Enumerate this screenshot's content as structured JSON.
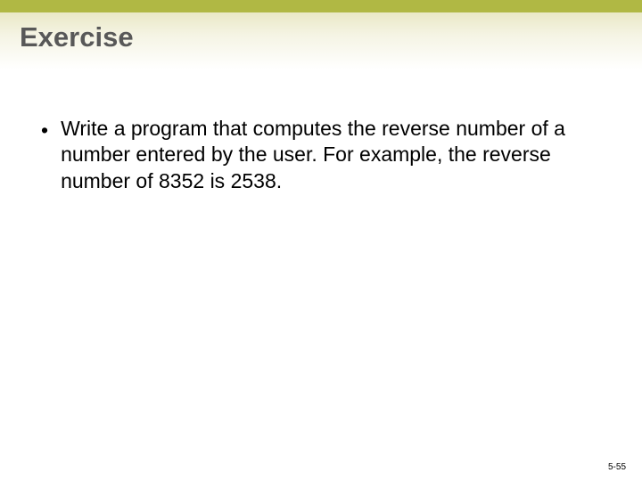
{
  "title": "Exercise",
  "bullet_glyph": "•",
  "body": "Write a program that computes the reverse number of a number entered by the user. For example, the reverse number of 8352 is 2538.",
  "page_number": "5-55"
}
